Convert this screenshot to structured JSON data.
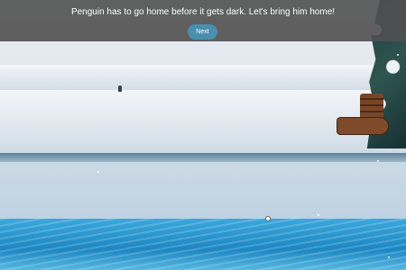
{
  "banner": {
    "message": "Penguin has to go home before it gets dark. Let's bring him home!",
    "next_label": "Next"
  },
  "scene": {
    "objects": [
      "penguin",
      "sled",
      "snowy-pine-tree",
      "ice-floe",
      "ocean-water"
    ]
  },
  "colors": {
    "banner_bg": "#505050",
    "button_bg": "#4a8eb0",
    "water": "#1c86c2",
    "ice": "#cad9e6"
  }
}
